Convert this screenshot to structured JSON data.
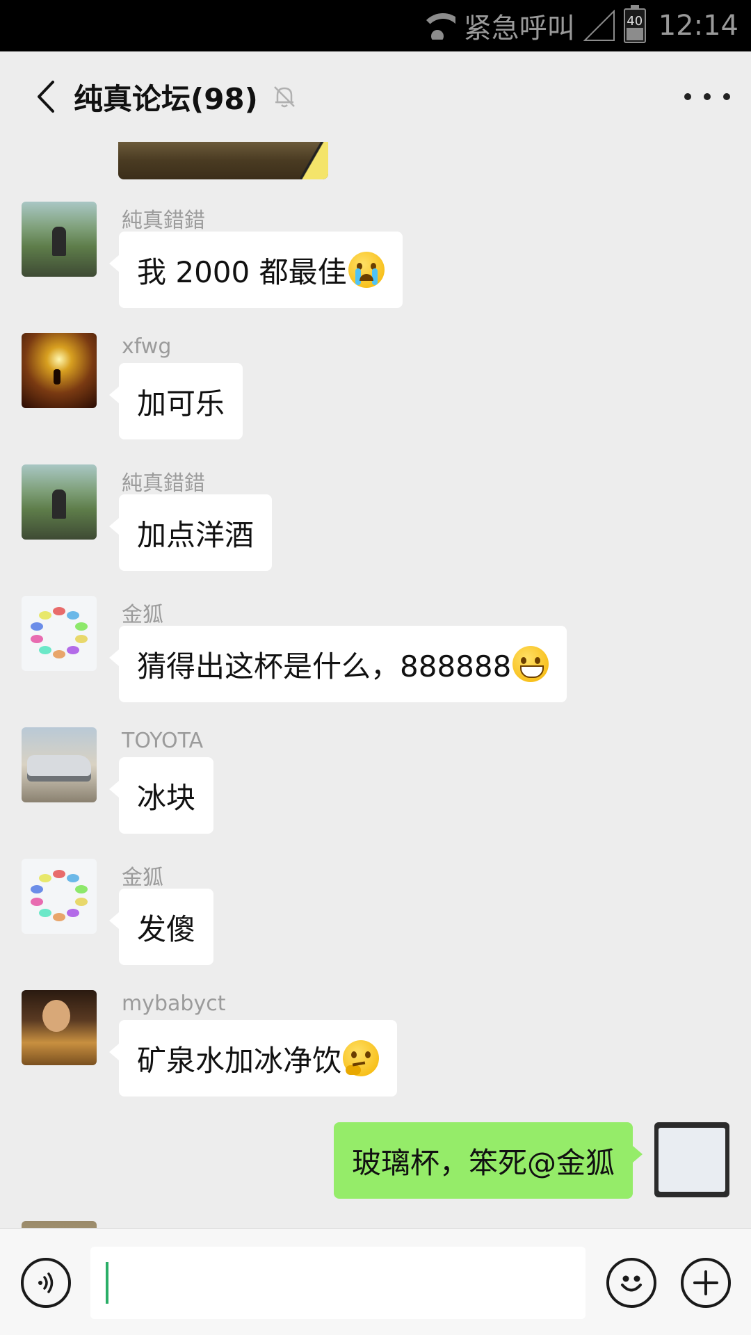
{
  "status_bar": {
    "emergency_text": "紧急呼叫",
    "battery_level": "40",
    "time": "12:14",
    "icons": [
      "wifi-icon",
      "signal-icon",
      "battery-icon"
    ]
  },
  "header": {
    "title": "纯真论坛(98)",
    "icons": [
      "back-arrow-icon",
      "mute-bell-icon",
      "more-dots-icon"
    ]
  },
  "messages": [
    {
      "sender": "純真錯錯",
      "text": "我 2000 都最佳",
      "emoji": "crying-face-icon",
      "direction": "incoming"
    },
    {
      "sender": "xfwg",
      "text": "加可乐",
      "emoji": "",
      "direction": "incoming"
    },
    {
      "sender": "純真錯錯",
      "text": "加点洋酒",
      "emoji": "",
      "direction": "incoming"
    },
    {
      "sender": "金狐",
      "text": "猜得出这杯是什么，888888",
      "emoji": "grinning-face-icon",
      "direction": "incoming"
    },
    {
      "sender": "TOYOTA",
      "text": "冰块",
      "emoji": "",
      "direction": "incoming"
    },
    {
      "sender": "金狐",
      "text": "发傻",
      "emoji": "",
      "direction": "incoming"
    },
    {
      "sender": "mybabyct",
      "text": "矿泉水加冰净饮",
      "emoji": "thinking-face-icon",
      "direction": "incoming"
    },
    {
      "sender": "",
      "text": "玻璃杯，笨死@金狐",
      "emoji": "",
      "direction": "outgoing"
    }
  ],
  "input_bar": {
    "value": "",
    "icons": [
      "voice-icon",
      "emoji-icon",
      "plus-icon"
    ]
  },
  "colors": {
    "background": "#ededed",
    "incoming_bubble": "#ffffff",
    "outgoing_bubble": "#95ec69",
    "caret": "#2aae67"
  }
}
